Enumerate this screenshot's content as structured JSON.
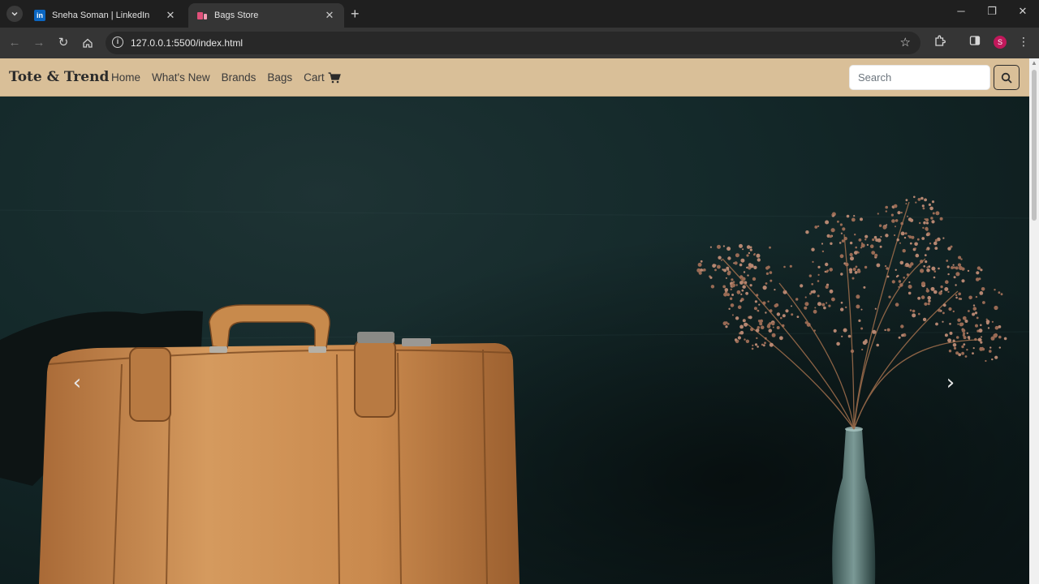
{
  "browser": {
    "tabs": [
      {
        "title": "Sneha Soman | LinkedIn",
        "favicon_color": "#0a66c2",
        "favicon_text": "in"
      },
      {
        "title": "Bags Store",
        "favicon_color": "#e0507a"
      }
    ],
    "url": "127.0.0.1:5500/index.html",
    "profile_initial": "S"
  },
  "site": {
    "brand": "Tote & Trend",
    "nav": {
      "home": "Home",
      "whats_new": "What's New",
      "brands": "Brands",
      "bags": "Bags",
      "cart": "Cart"
    },
    "search": {
      "placeholder": "Search"
    }
  },
  "colors": {
    "navbar_bg": "#d9bf98",
    "hero_bg": "#13292a",
    "bag_leather": "#c68a4f"
  },
  "icons": {
    "cart": "cart-icon",
    "search": "search-icon",
    "prev": "chevron-left-icon",
    "next": "chevron-right-icon"
  }
}
